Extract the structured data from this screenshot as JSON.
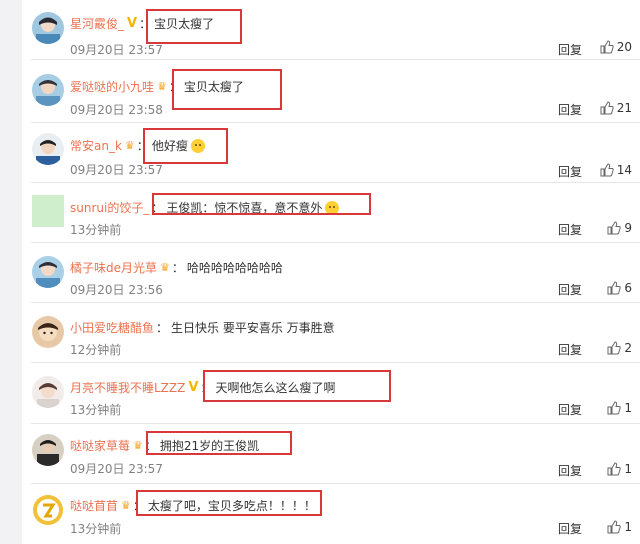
{
  "colors": {
    "username": "#eb7350",
    "highlight": "#d8383a",
    "vip": "#f6b300"
  },
  "actions": {
    "reply_label": "回复",
    "like_icon": "thumbs-up-icon"
  },
  "comments": [
    {
      "user": "星河霰俊_",
      "badge": "V",
      "text": "宝贝太瘦了",
      "time": "09月20日 23:57",
      "likes": "20",
      "highlighted": true
    },
    {
      "user": "爱哒哒的小九哇",
      "badge": "crown",
      "text": "宝贝太瘦了",
      "time": "09月20日 23:58",
      "likes": "21",
      "highlighted": true
    },
    {
      "user": "常安an_k",
      "badge": "crown",
      "text": "他好瘦",
      "emoji": "crying-face",
      "time": "09月20日 23:57",
      "likes": "14",
      "highlighted": true
    },
    {
      "user": "sunrui的饺子_",
      "text": "王俊凯：惊不惊喜，意不意外",
      "emoji": "winking-face",
      "time": "13分钟前",
      "likes": "9",
      "highlighted": true
    },
    {
      "user": "橘子味de月光草",
      "badge": "crown",
      "text": "哈哈哈哈哈哈哈哈",
      "time": "09月20日 23:56",
      "likes": "6",
      "highlighted": false
    },
    {
      "user": "小田爱吃糖醋鱼",
      "text": "生日快乐 要平安喜乐 万事胜意",
      "time": "12分钟前",
      "likes": "2",
      "highlighted": false
    },
    {
      "user": "月亮不睡我不睡LZZZ",
      "badge": "V",
      "text": "天啊他怎么这么瘦了啊",
      "time": "13分钟前",
      "likes": "1",
      "highlighted": true
    },
    {
      "user": "哒哒家草莓",
      "badge": "crown",
      "text": "拥抱21岁的王俊凯",
      "time": "09月20日 23:57",
      "likes": "1",
      "highlighted": true
    },
    {
      "user": "哒哒苜苜",
      "badge": "crown",
      "text": "太瘦了吧，宝贝多吃点！！！！",
      "time": "13分钟前",
      "likes": "1",
      "highlighted": true
    }
  ]
}
